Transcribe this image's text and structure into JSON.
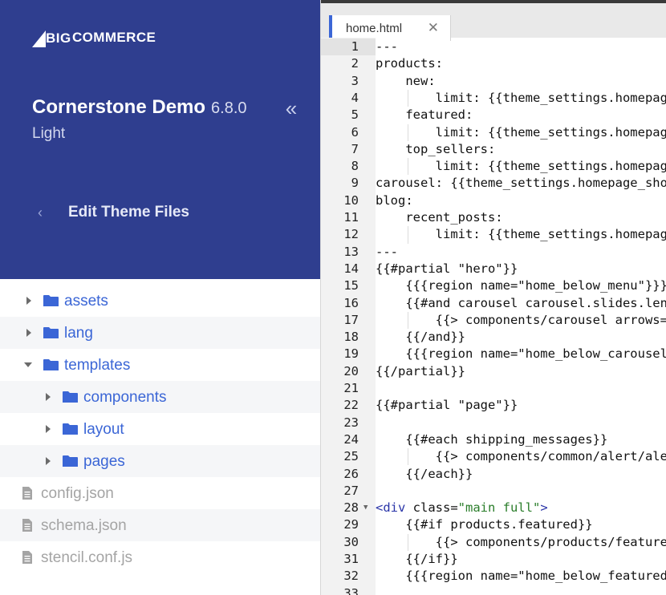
{
  "brand": {
    "big": "BIG",
    "rest": "COMMERCE"
  },
  "theme": {
    "name": "Cornerstone Demo",
    "version": "6.8.0",
    "variant": "Light",
    "collapse_icon": "double-chevron-left-icon"
  },
  "nav": {
    "back_label": "Edit Theme Files",
    "back_icon": "chevron-left-icon"
  },
  "tree": [
    {
      "type": "folder",
      "label": "assets",
      "depth": 0,
      "expanded": false
    },
    {
      "type": "folder",
      "label": "lang",
      "depth": 0,
      "expanded": false
    },
    {
      "type": "folder",
      "label": "templates",
      "depth": 0,
      "expanded": true
    },
    {
      "type": "folder",
      "label": "components",
      "depth": 1,
      "expanded": false
    },
    {
      "type": "folder",
      "label": "layout",
      "depth": 1,
      "expanded": false
    },
    {
      "type": "folder",
      "label": "pages",
      "depth": 1,
      "expanded": false
    },
    {
      "type": "file",
      "label": "config.json",
      "depth": 0
    },
    {
      "type": "file",
      "label": "schema.json",
      "depth": 0
    },
    {
      "type": "file",
      "label": "stencil.conf.js",
      "depth": 0
    }
  ],
  "editor": {
    "tab": {
      "label": "home.html",
      "close_icon": "close-icon"
    },
    "active_line": 1,
    "lines": [
      "---",
      "products:",
      "    new:",
      "        limit: {{theme_settings.homepage_new_products_count}}",
      "    featured:",
      "        limit: {{theme_settings.homepage_featured_products_count}}",
      "    top_sellers:",
      "        limit: {{theme_settings.homepage_top_products_count}}",
      "carousel: {{theme_settings.homepage_show_carousel}}",
      "blog:",
      "    recent_posts:",
      "        limit: {{theme_settings.homepage_blog_posts_count}}",
      "---",
      "{{#partial \"hero\"}}",
      "    {{{region name=\"home_below_menu\"}}}",
      "    {{#and carousel carousel.slides.length}}",
      "        {{> components/carousel arrows=theme_settings.homepage_show_carousel_arrows}}",
      "    {{/and}}",
      "    {{{region name=\"home_below_carousel\"}}}",
      "{{/partial}}",
      "",
      "{{#partial \"page\"}}",
      "",
      "    {{#each shipping_messages}}",
      "        {{> components/common/alert/alert-info message}}",
      "    {{/each}}",
      "",
      "<div class=\"main full\">",
      "    {{#if products.featured}}",
      "        {{> components/products/featured products=products.featured}}",
      "    {{/if}}",
      "    {{{region name=\"home_below_featured_products\"}}}",
      ""
    ],
    "fold_markers": [
      28
    ]
  }
}
